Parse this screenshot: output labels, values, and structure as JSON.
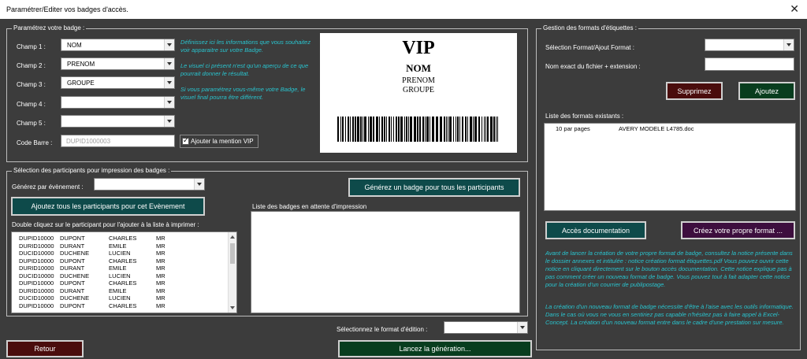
{
  "window": {
    "title": "Paramétrer/Editer vos badges d'accès."
  },
  "badge_settings": {
    "legend": "Paramétrez votre badge :",
    "fields": [
      {
        "label": "Champ 1 :",
        "value": "NOM"
      },
      {
        "label": "Champ 2 :",
        "value": "PRENOM"
      },
      {
        "label": "Champ 3 :",
        "value": "GROUPE"
      },
      {
        "label": "Champ 4 :",
        "value": ""
      },
      {
        "label": "Champ 5 :",
        "value": ""
      }
    ],
    "barcode_label": "Code Barre :",
    "barcode_value": "DUPID1000003",
    "vip_checkbox_label": "Ajouter la mention VIP",
    "vip_checked": true,
    "hints": [
      "Définissez ici les informations que vous souhaitez voir apparaitre sur votre Badge.",
      "Le visuel ci présent n'est qu'un aperçu de ce que pourrait donner le résultat.",
      "Si vous paramétrez vous-même votre Badge, le visuel final pourra être différent."
    ]
  },
  "preview": {
    "vip": "VIP",
    "line1": "NOM",
    "line2": "PRENOM",
    "line3": "GROUPE"
  },
  "participants": {
    "legend": "Sélection des participants pour impression des badges :",
    "event_label": "Générez par évènement :",
    "event_value": "",
    "generate_all_button": "Générez un badge pour tous les participants",
    "add_all_button": "Ajoutez tous les participants pour cet Evènement",
    "list_label": "Double cliquez sur le participant pour l'ajouter à la liste à imprimer :",
    "rows": [
      [
        "DUPID10000",
        "DUPONT",
        "CHARLES",
        "MR"
      ],
      [
        "DURID10000",
        "DURANT",
        "EMILE",
        "MR"
      ],
      [
        "DUCID10000",
        "DUCHENE",
        "LUCIEN",
        "MR"
      ],
      [
        "DUPID10000",
        "DUPONT",
        "CHARLES",
        "MR"
      ],
      [
        "DURID10000",
        "DURANT",
        "EMILE",
        "MR"
      ],
      [
        "DUCID10000",
        "DUCHENE",
        "LUCIEN",
        "MR"
      ],
      [
        "DUPID10000",
        "DUPONT",
        "CHARLES",
        "MR"
      ],
      [
        "DURID10000",
        "DURANT",
        "EMILE",
        "MR"
      ],
      [
        "DUCID10000",
        "DUCHENE",
        "LUCIEN",
        "MR"
      ],
      [
        "DUPID10000",
        "DUPONT",
        "CHARLES",
        "MR"
      ]
    ],
    "pending_label": "Liste des badges en attente d'impression"
  },
  "bottom": {
    "edition_format_label": "Sélectionnez le format d'édition :",
    "edition_format_value": "",
    "return_button": "Retour",
    "launch_button": "Lancez la génération..."
  },
  "formats": {
    "legend": "Gestion des formats d'étiquettes :",
    "select_label": "Sélection Format/Ajout Format :",
    "select_value": "",
    "filename_label": "Nom exact du fichier + extension :",
    "filename_value": "",
    "delete_button": "Supprimez",
    "add_button": "Ajoutez",
    "list_label": "Liste des formats existants :",
    "list_rows": [
      [
        "10 par pages",
        "AVERY MODELE L4785.doc"
      ]
    ],
    "doc_button": "Accès documentation",
    "create_button": "Créez votre propre format ...",
    "notice_1": "Avant de lancer la création de votre propre format de badge, consultez la notice présente dans le dossier annexes et intitulée : notice création format étiquettes.pdf Vous pouvez ouvrir cette notice en cliquant directement sur le bouton accès documentation. Cette notice explique pas à pas comment créer un nouveau format de badge. Vous pouvez tout à fait adapter cette notice pour la création d'un courrier de publipostage.",
    "notice_2": "La création d'un nouveau format de badge nécessite d'être à l'aise avec les outils informatique. Dans le cas où vous ne vous en sentiriez pas capable n'hésitez pas à faire appel à Excel-Concept. La création d'un nouveau format entre dans le cadre d'une prestation sur mesure."
  },
  "colors": {
    "background": "#3c3c3c",
    "hint_text": "#29c5d0",
    "teal_button": "#0e4a4a",
    "red_button": "#4a0d0d",
    "green_button": "#083d1e",
    "purple_button": "#3d0e3e"
  }
}
